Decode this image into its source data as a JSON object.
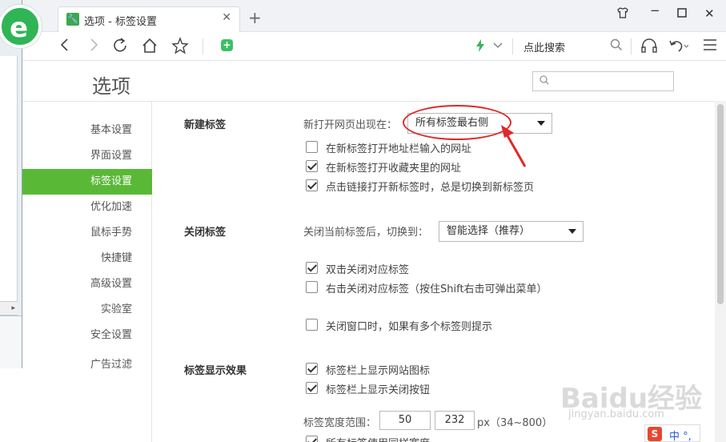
{
  "browser": {
    "tab_title": "选项 - 标签设置",
    "new_tab": "+",
    "close_tab": "✕",
    "search_hint": "点此搜索",
    "window_controls": [
      "shirt-icon",
      "minimize-icon",
      "maximize-icon",
      "close-icon"
    ],
    "nav_icons": [
      "back-icon",
      "forward-icon",
      "refresh-icon",
      "home-icon",
      "star-icon",
      "extension-icon",
      "lightning-icon",
      "headset-icon",
      "undo-icon",
      "menu-icon"
    ],
    "logo_letter": "e"
  },
  "page": {
    "title": "选项",
    "search_placeholder": ""
  },
  "sidebar": {
    "items": [
      {
        "label": "基本设置"
      },
      {
        "label": "界面设置"
      },
      {
        "label": "标签设置",
        "active": true
      },
      {
        "label": "优化加速"
      },
      {
        "label": "鼠标手势"
      },
      {
        "label": "快捷键"
      },
      {
        "label": "高级设置"
      },
      {
        "label": "实验室"
      },
      {
        "label": "安全设置"
      },
      {
        "label": "广告过滤"
      }
    ]
  },
  "new_tab_section": {
    "title": "新建标签",
    "open_position_label": "新打开网页出现在：",
    "open_position_value": "所有标签最右侧",
    "options": [
      {
        "label": "在新标签打开地址栏输入的网址",
        "checked": false
      },
      {
        "label": "在新标签打开收藏夹里的网址",
        "checked": true
      },
      {
        "label": "点击链接打开新标签时，总是切换到新标签页",
        "checked": true
      }
    ]
  },
  "close_tab_section": {
    "title": "关闭标签",
    "after_close_label": "关闭当前标签后，切换到：",
    "after_close_value": "智能选择（推荐）",
    "options": [
      {
        "label": "双击关闭对应标签",
        "checked": true
      },
      {
        "label": "右击关闭对应标签（按住Shift右击可弹出菜单）",
        "checked": false
      },
      {
        "label": "关闭窗口时，如果有多个标签则提示",
        "checked": false
      }
    ]
  },
  "display_section": {
    "title": "标签显示效果",
    "options": [
      {
        "label": "标签栏上显示网站图标",
        "checked": true
      },
      {
        "label": "标签栏上显示关闭按钮",
        "checked": true
      }
    ],
    "width_label": "标签宽度范围：",
    "width_min": "50",
    "width_sep": "~",
    "width_max": "232",
    "width_unit": "px（34~800）",
    "last_option": {
      "label": "所有标签使用同样宽度",
      "checked": true
    }
  },
  "colors": {
    "accent": "#5ab837",
    "annotation": "#e02828"
  },
  "watermark": {
    "brand": "Baidu经验",
    "url": "jingyan.baidu.com"
  },
  "ime": {
    "badge": "S",
    "text": "中 °,"
  }
}
